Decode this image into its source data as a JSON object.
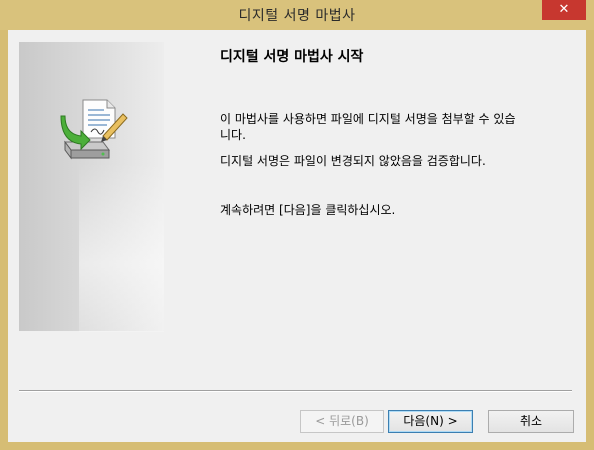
{
  "window": {
    "title": "디지털 서명 마법사",
    "close_label": "✕"
  },
  "content": {
    "heading": "디지털 서명 마법사 시작",
    "paragraph1": "이 마법사를 사용하면 파일에 디지털 서명을 첨부할 수 있습니다.",
    "paragraph2": "디지털 서명은 파일이 변경되지 않았음을 검증합니다.",
    "paragraph3": "계속하려면 [다음]을 클릭하십시오."
  },
  "buttons": {
    "back": "< 뒤로(B)",
    "next": "다음(N) >",
    "cancel": "취소"
  },
  "icons": {
    "wizard": "signature-wizard-icon",
    "close": "close-icon"
  },
  "colors": {
    "titlebar": "#d9c27c",
    "close": "#c7372f",
    "client": "#f0f0f0",
    "focus_border": "#3c7fb1"
  }
}
